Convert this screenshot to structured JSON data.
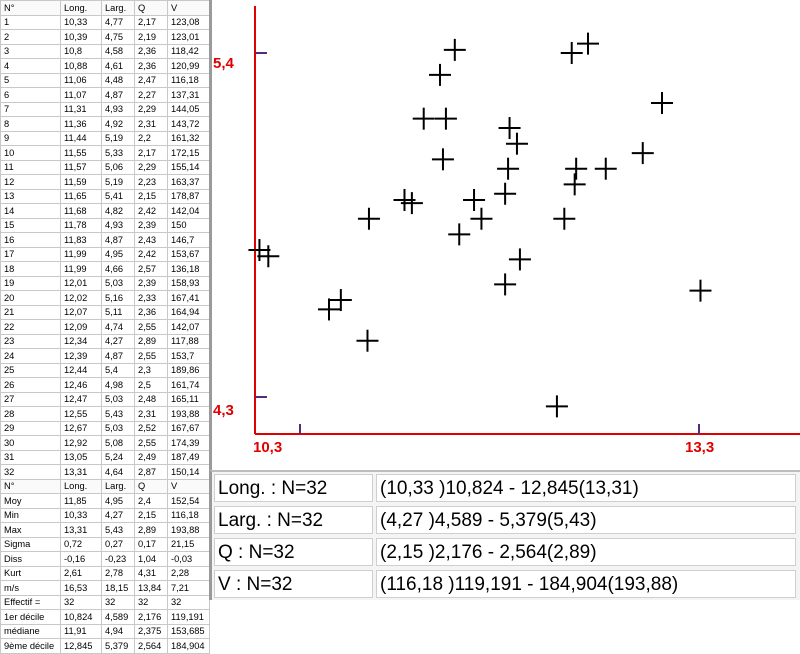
{
  "table": {
    "header": [
      "N°",
      "Long.",
      "Larg.",
      "Q",
      "V"
    ],
    "rows": [
      [
        "1",
        "10,33",
        "4,77",
        "2,17",
        "123,08"
      ],
      [
        "2",
        "10,39",
        "4,75",
        "2,19",
        "123,01"
      ],
      [
        "3",
        "10,8",
        "4,58",
        "2,36",
        "118,42"
      ],
      [
        "4",
        "10,88",
        "4,61",
        "2,36",
        "120,99"
      ],
      [
        "5",
        "11,06",
        "4,48",
        "2,47",
        "116,18"
      ],
      [
        "6",
        "11,07",
        "4,87",
        "2,27",
        "137,31"
      ],
      [
        "7",
        "11,31",
        "4,93",
        "2,29",
        "144,05"
      ],
      [
        "8",
        "11,36",
        "4,92",
        "2,31",
        "143,72"
      ],
      [
        "9",
        "11,44",
        "5,19",
        "2,2",
        "161,32"
      ],
      [
        "10",
        "11,55",
        "5,33",
        "2,17",
        "172,15"
      ],
      [
        "11",
        "11,57",
        "5,06",
        "2,29",
        "155,14"
      ],
      [
        "12",
        "11,59",
        "5,19",
        "2,23",
        "163,37"
      ],
      [
        "13",
        "11,65",
        "5,41",
        "2,15",
        "178,87"
      ],
      [
        "14",
        "11,68",
        "4,82",
        "2,42",
        "142,04"
      ],
      [
        "15",
        "11,78",
        "4,93",
        "2,39",
        "150"
      ],
      [
        "16",
        "11,83",
        "4,87",
        "2,43",
        "146,7"
      ],
      [
        "17",
        "11,99",
        "4,95",
        "2,42",
        "153,67"
      ],
      [
        "18",
        "11,99",
        "4,66",
        "2,57",
        "136,18"
      ],
      [
        "19",
        "12,01",
        "5,03",
        "2,39",
        "158,93"
      ],
      [
        "20",
        "12,02",
        "5,16",
        "2,33",
        "167,41"
      ],
      [
        "21",
        "12,07",
        "5,11",
        "2,36",
        "164,94"
      ],
      [
        "22",
        "12,09",
        "4,74",
        "2,55",
        "142,07"
      ],
      [
        "23",
        "12,34",
        "4,27",
        "2,89",
        "117,88"
      ],
      [
        "24",
        "12,39",
        "4,87",
        "2,55",
        "153,7"
      ],
      [
        "25",
        "12,44",
        "5,4",
        "2,3",
        "189,86"
      ],
      [
        "26",
        "12,46",
        "4,98",
        "2,5",
        "161,74"
      ],
      [
        "27",
        "12,47",
        "5,03",
        "2,48",
        "165,11"
      ],
      [
        "28",
        "12,55",
        "5,43",
        "2,31",
        "193,88"
      ],
      [
        "29",
        "12,67",
        "5,03",
        "2,52",
        "167,67"
      ],
      [
        "30",
        "12,92",
        "5,08",
        "2,55",
        "174,39"
      ],
      [
        "31",
        "13,05",
        "5,24",
        "2,49",
        "187,49"
      ],
      [
        "32",
        "13,31",
        "4,64",
        "2,87",
        "150,14"
      ]
    ],
    "stats_header": [
      "N°",
      "Long.",
      "Larg.",
      "Q",
      "V"
    ],
    "stats_rows": [
      [
        "Moy",
        "11,85",
        "4,95",
        "2,4",
        "152,54"
      ],
      [
        "Min",
        "10,33",
        "4,27",
        "2,15",
        "116,18"
      ],
      [
        "Max",
        "13,31",
        "5,43",
        "2,89",
        "193,88"
      ],
      [
        "Sigma",
        "0,72",
        "0,27",
        "0,17",
        "21,15"
      ],
      [
        "Diss",
        "-0,16",
        "-0,23",
        "1,04",
        "-0,03"
      ],
      [
        "Kurt",
        "2,61",
        "2,78",
        "4,31",
        "2,28"
      ],
      [
        "m/s",
        "16,53",
        "18,15",
        "13,84",
        "7,21"
      ],
      [
        "Effectif =",
        "32",
        "32",
        "32",
        "32"
      ],
      [
        "1er décile",
        "10,824",
        "4,589",
        "2,176",
        "119,191"
      ],
      [
        "médiane",
        "11,91",
        "4,94",
        "2,375",
        "153,685"
      ],
      [
        "9ème décile",
        "12,845",
        "5,379",
        "2,564",
        "184,904"
      ]
    ]
  },
  "chart_data": {
    "type": "scatter",
    "x_tick_labels": {
      "min": "10,3",
      "max": "13,3"
    },
    "y_tick_labels": {
      "min": "4,3",
      "max": "5,4"
    },
    "xlim": [
      10.3,
      13.3
    ],
    "ylim": [
      4.3,
      5.4
    ],
    "axis_color": "#e00000",
    "marker": "plus",
    "points": [
      [
        10.33,
        4.77
      ],
      [
        10.39,
        4.75
      ],
      [
        10.8,
        4.58
      ],
      [
        10.88,
        4.61
      ],
      [
        11.06,
        4.48
      ],
      [
        11.07,
        4.87
      ],
      [
        11.31,
        4.93
      ],
      [
        11.36,
        4.92
      ],
      [
        11.44,
        5.19
      ],
      [
        11.55,
        5.33
      ],
      [
        11.57,
        5.06
      ],
      [
        11.59,
        5.19
      ],
      [
        11.65,
        5.41
      ],
      [
        11.68,
        4.82
      ],
      [
        11.78,
        4.93
      ],
      [
        11.83,
        4.87
      ],
      [
        11.99,
        4.95
      ],
      [
        11.99,
        4.66
      ],
      [
        12.01,
        5.03
      ],
      [
        12.02,
        5.16
      ],
      [
        12.07,
        5.11
      ],
      [
        12.09,
        4.74
      ],
      [
        12.34,
        4.27
      ],
      [
        12.39,
        4.87
      ],
      [
        12.44,
        5.4
      ],
      [
        12.46,
        4.98
      ],
      [
        12.47,
        5.03
      ],
      [
        12.55,
        5.43
      ],
      [
        12.67,
        5.03
      ],
      [
        12.92,
        5.08
      ],
      [
        13.05,
        5.24
      ],
      [
        13.31,
        4.64
      ]
    ]
  },
  "summary": [
    {
      "name": "Long. : N=32",
      "range": "(10,33 )10,824 - 12,845(13,31)"
    },
    {
      "name": "Larg. : N=32",
      "range": "(4,27 )4,589 - 5,379(5,43)"
    },
    {
      "name": "Q : N=32",
      "range": "(2,15 )2,176 - 2,564(2,89)"
    },
    {
      "name": "V : N=32",
      "range": "(116,18 )119,191 - 184,904(193,88)"
    }
  ]
}
